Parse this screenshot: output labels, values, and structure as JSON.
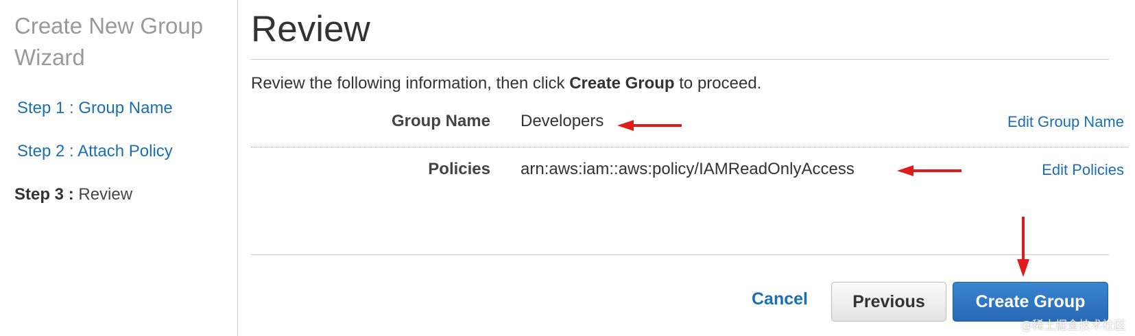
{
  "sidebar": {
    "title": "Create New Group Wizard",
    "steps": [
      {
        "label": "Step 1 : Group Name"
      },
      {
        "label": "Step 2 : Attach Policy"
      },
      {
        "prefix": "Step 3 :",
        "label": "Review"
      }
    ]
  },
  "main": {
    "heading": "Review",
    "instruction": {
      "before": "Review the following information, then click ",
      "bold": "Create Group",
      "after": " to proceed."
    },
    "rows": [
      {
        "label": "Group Name",
        "value": "Developers",
        "edit": "Edit Group Name"
      },
      {
        "label": "Policies",
        "value": "arn:aws:iam::aws:policy/IAMReadOnlyAccess",
        "edit": "Edit Policies"
      }
    ]
  },
  "footer": {
    "cancel": "Cancel",
    "previous": "Previous",
    "create": "Create Group"
  },
  "watermark": "@稀土掘金技术社区",
  "colors": {
    "link": "#1a6eb5",
    "primary_button": "#2769b5",
    "annotation_arrow": "#e01b1b"
  }
}
